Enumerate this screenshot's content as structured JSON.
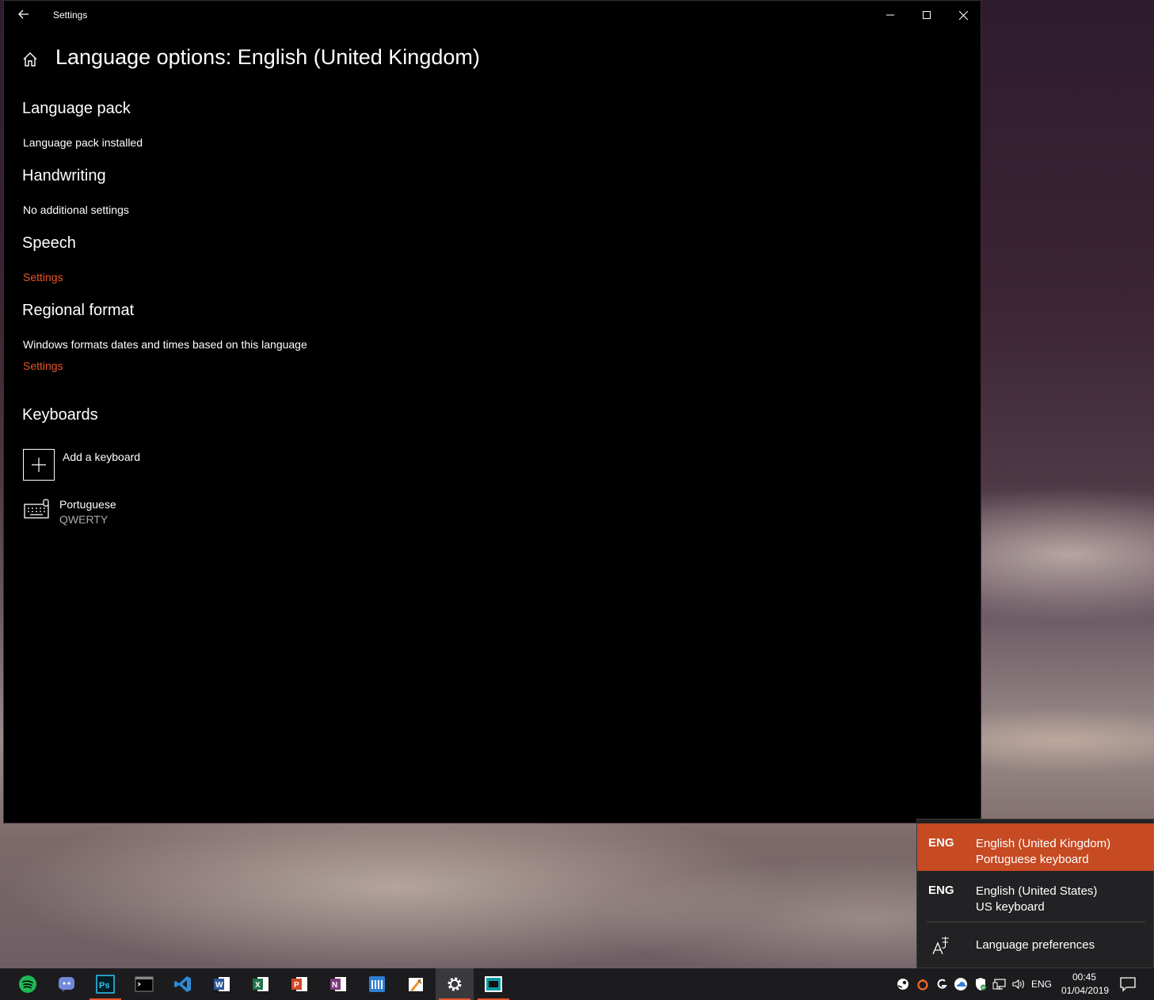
{
  "window": {
    "title": "Settings",
    "page_title": "Language options: English (United Kingdom)"
  },
  "sections": {
    "language_pack": {
      "heading": "Language pack",
      "status": "Language pack installed"
    },
    "handwriting": {
      "heading": "Handwriting",
      "status": "No additional settings"
    },
    "speech": {
      "heading": "Speech",
      "link": "Settings"
    },
    "regional_format": {
      "heading": "Regional format",
      "description": "Windows formats dates and times based on this language",
      "link": "Settings"
    },
    "keyboards": {
      "heading": "Keyboards",
      "add_label": "Add a keyboard",
      "items": [
        {
          "name": "Portuguese",
          "layout": "QWERTY"
        }
      ]
    }
  },
  "flyout": {
    "items": [
      {
        "code": "ENG",
        "language": "English (United Kingdom)",
        "keyboard": "Portuguese keyboard",
        "selected": true
      },
      {
        "code": "ENG",
        "language": "English (United States)",
        "keyboard": "US keyboard",
        "selected": false
      }
    ],
    "preferences_label": "Language preferences"
  },
  "taskbar": {
    "apps": [
      "spotify-icon",
      "discord-icon",
      "photoshop-icon",
      "terminal-icon",
      "vscode-icon",
      "word-icon",
      "excel-icon",
      "powerpoint-icon",
      "onenote-icon",
      "calculator-icon",
      "paint-icon",
      "settings-icon",
      "media-app-icon"
    ],
    "tray": {
      "input_indicator": "ENG",
      "time": "00:45",
      "date": "01/04/2019"
    }
  },
  "colors": {
    "accent": "#e8542b",
    "flyout_selected": "#c64a22",
    "window_bg": "#000000"
  }
}
